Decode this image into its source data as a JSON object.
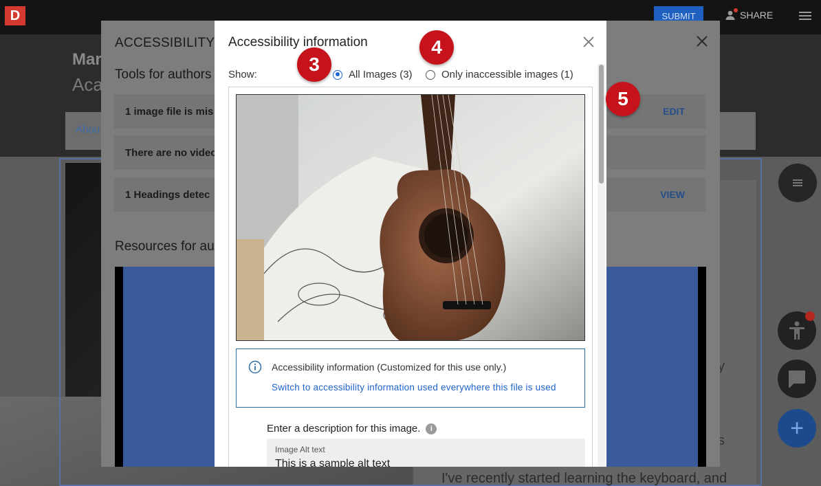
{
  "app": {
    "logo_letter": "D",
    "submit_label": "SUBMIT",
    "share_label": "SHARE",
    "course_title": "Mar",
    "course_subtitle": "Aca",
    "about_tab": "Abou",
    "bg_text_line": "I've recently started learning the keyboard, and",
    "bg_text_frag_1": "y",
    "bg_text_frag_2": "s"
  },
  "accessibility_panel": {
    "title": "ACCESSIBILITY",
    "tools_heading": "Tools for authors",
    "rows": [
      {
        "label": "1 image file is mis",
        "action": "EDIT"
      },
      {
        "label": "There are no video",
        "action": ""
      },
      {
        "label": "1 Headings detec",
        "action": "VIEW"
      }
    ],
    "resources_heading": "Resources for au"
  },
  "modal": {
    "title": "Accessibility information",
    "show_label": "Show:",
    "radio_all": "All Images (3)",
    "radio_inaccessible": "Only inaccessible images (1)",
    "selected": "all",
    "info_title": "Accessibility information (Customized for this use only.)",
    "info_link": "Switch to accessibility information used everywhere this file is used",
    "desc_label": "Enter a description for this image.",
    "alt_field_label": "Image Alt text",
    "alt_field_value": "This is a sample alt text"
  },
  "callouts": [
    "3",
    "4",
    "5"
  ],
  "colors": {
    "callout_red": "#c6131b",
    "link_blue": "#1d62c9",
    "info_border": "#2f6fa7",
    "submit_blue": "#1f5fbf"
  },
  "icons": [
    "close-icon",
    "info-icon",
    "help-icon",
    "person-icon",
    "menu-icon",
    "accessibility-icon",
    "chat-icon",
    "plus-icon"
  ]
}
